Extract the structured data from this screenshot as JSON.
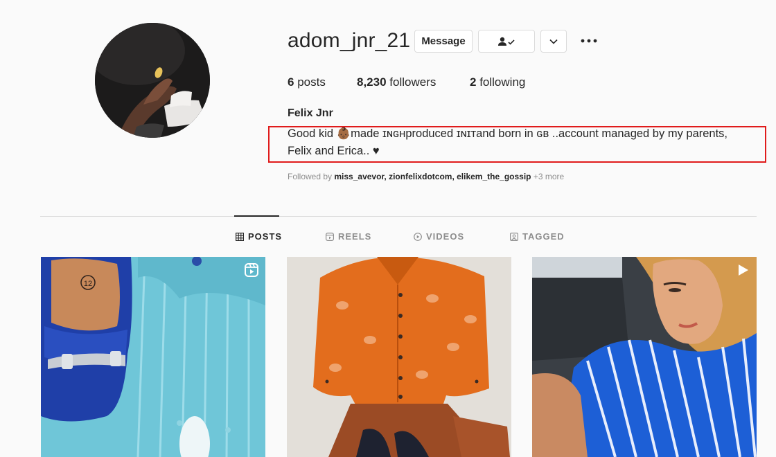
{
  "profile": {
    "username": "adom_jnr_21",
    "message_label": "Message",
    "stats": {
      "posts_count": "6",
      "posts_label": "posts",
      "followers_count": "8,230",
      "followers_label": "followers",
      "following_count": "2",
      "following_label": "following"
    },
    "full_name": "Felix Jnr",
    "bio_line1": "Good kid 👶🏾made ɪɴɢʜproduced ɪɴɪᴛand born in ɢʙ ..account managed by my parents,",
    "bio_line2": "Felix and Erica.. ♥",
    "followed_by_prefix": "Followed by",
    "followed_by_names": "miss_avevor, zionfelixdotcom, elikem_the_gossip",
    "followed_by_more": "+3 more"
  },
  "tabs": [
    {
      "label": "POSTS",
      "icon": "grid-icon",
      "active": true
    },
    {
      "label": "REELS",
      "icon": "reels-icon",
      "active": false
    },
    {
      "label": "VIDEOS",
      "icon": "play-circle-icon",
      "active": false
    },
    {
      "label": "TAGGED",
      "icon": "tagged-icon",
      "active": false
    }
  ],
  "posts": [
    {
      "subject": "blue baby loafer with number 12 on a turquoise romper",
      "badge": "reels-icon"
    },
    {
      "subject": "orange patterned shirt with brown trousers",
      "badge": null
    },
    {
      "subject": "woman in blue striped shirt in a car",
      "badge": "play-icon"
    }
  ],
  "colors": {
    "background": "#fafafa",
    "text": "#262626",
    "muted": "#8e8e8e",
    "border": "#dbdbdb",
    "highlight": "#e01b1b"
  }
}
